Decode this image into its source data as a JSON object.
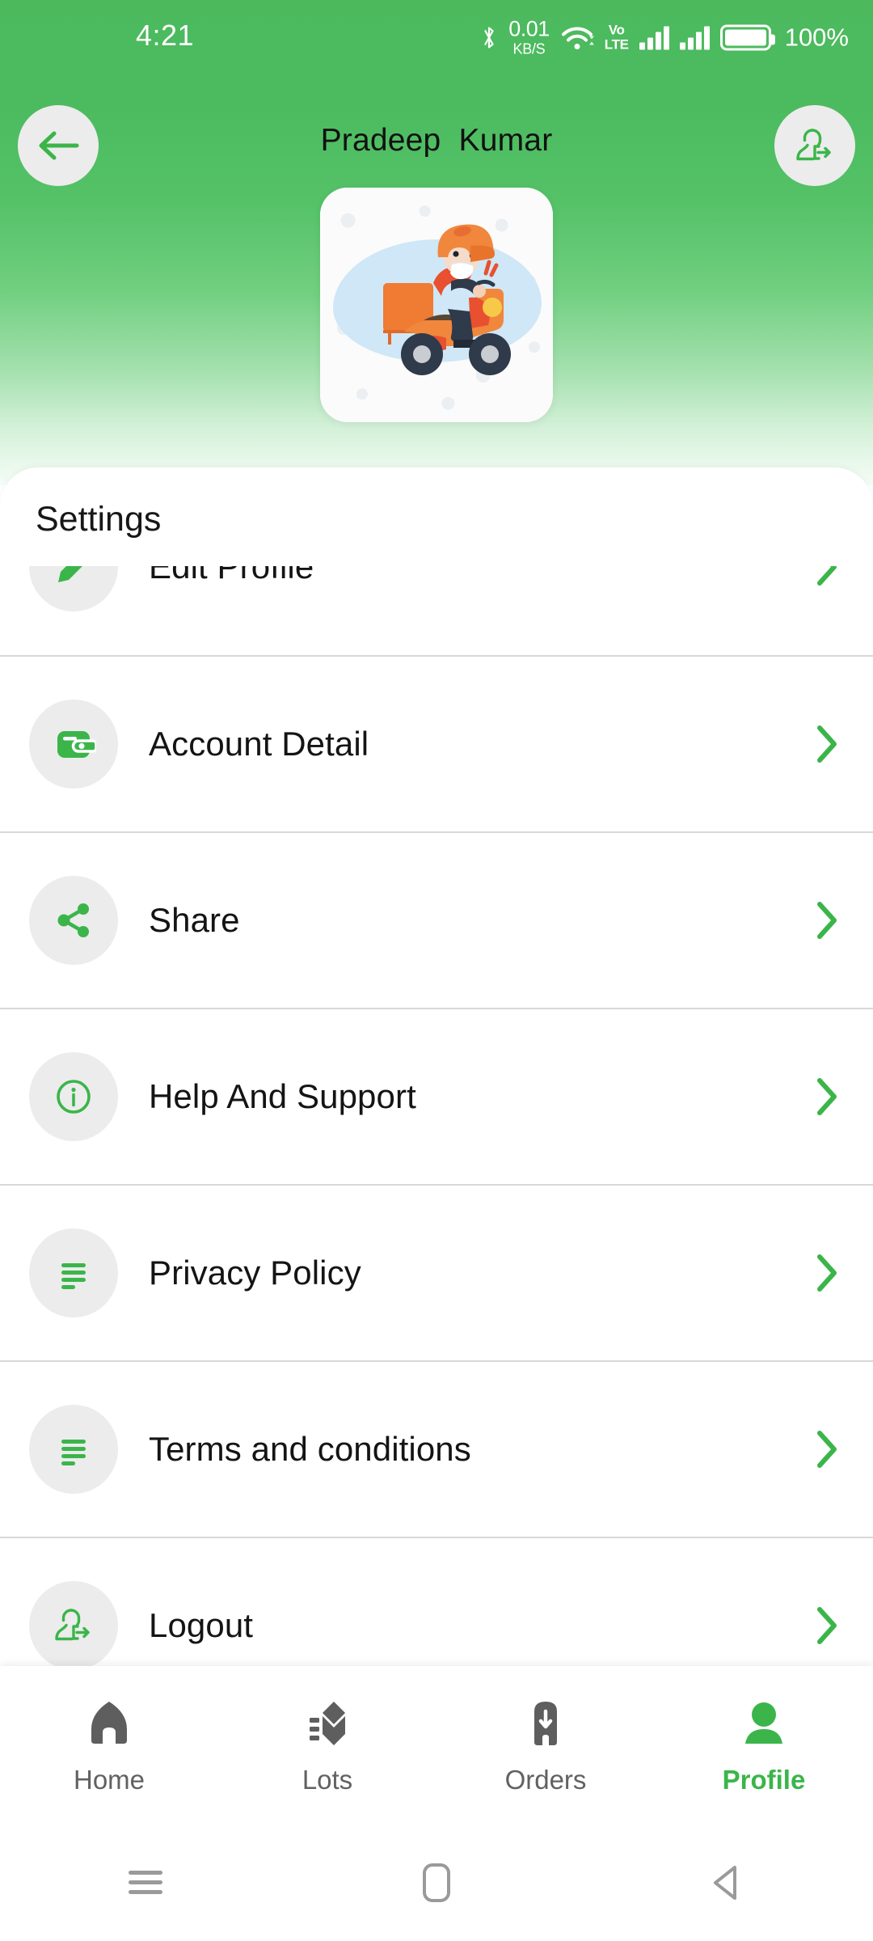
{
  "status_bar": {
    "time": "4:21",
    "bluetooth_icon": "bluetooth-icon",
    "network_speed_value": "0.01",
    "network_speed_unit": "KB/S",
    "wifi_icon": "wifi-icon",
    "volte_line1": "Vo",
    "volte_line2": "LTE",
    "signal_icon": "signal-bars-icon",
    "battery_icon": "battery-icon",
    "battery_percent": "100%"
  },
  "header": {
    "back_icon": "arrow-left-icon",
    "title": "Pradeep  Kumar",
    "logout_icon": "user-logout-icon",
    "avatar_alt": "delivery-rider-illustration",
    "gradient_top_color": "#4cb95d",
    "gradient_bottom_color": "#f4fcf6"
  },
  "settings": {
    "heading": "Settings",
    "accent_color": "#3bb54a",
    "items": [
      {
        "label": "Edit Profile",
        "icon": "pencil-edit-icon",
        "chevron": "chevron-right-icon"
      },
      {
        "label": "Account Detail",
        "icon": "wallet-icon",
        "chevron": "chevron-right-icon"
      },
      {
        "label": "Share",
        "icon": "share-icon",
        "chevron": "chevron-right-icon"
      },
      {
        "label": "Help And Support",
        "icon": "info-circle-icon",
        "chevron": "chevron-right-icon"
      },
      {
        "label": "Privacy Policy",
        "icon": "document-lines-icon",
        "chevron": "chevron-right-icon"
      },
      {
        "label": "Terms and conditions",
        "icon": "document-lines-icon",
        "chevron": "chevron-right-icon"
      },
      {
        "label": "Logout",
        "icon": "user-logout-icon",
        "chevron": "chevron-right-icon"
      }
    ]
  },
  "bottom_nav": {
    "active_color": "#3bb54a",
    "inactive_color": "#616161",
    "items": [
      {
        "label": "Home",
        "icon": "home-icon",
        "active": false
      },
      {
        "label": "Lots",
        "icon": "lots-box-icon",
        "active": false
      },
      {
        "label": "Orders",
        "icon": "orders-box-download-icon",
        "active": false
      },
      {
        "label": "Profile",
        "icon": "person-icon",
        "active": true
      }
    ]
  },
  "android_nav": {
    "recents_icon": "menu-recents-icon",
    "home_icon": "home-pill-icon",
    "back_icon": "back-triangle-icon"
  }
}
